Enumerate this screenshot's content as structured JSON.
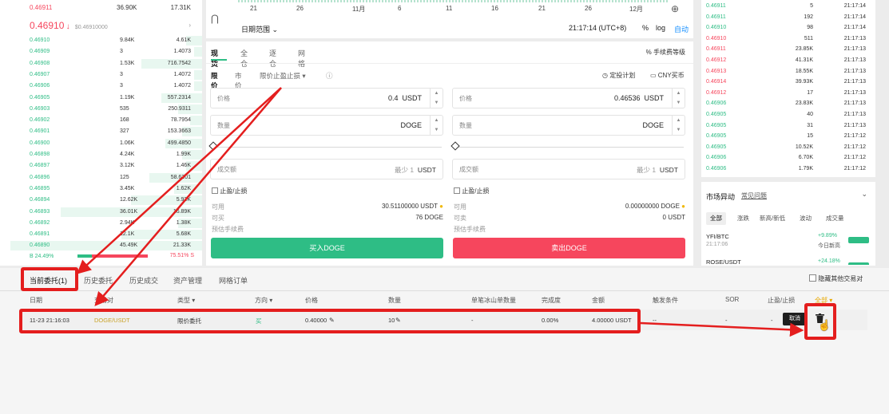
{
  "orderbook_left": {
    "top_row": {
      "price": "0.46911",
      "qty": "36.90K",
      "total": "17.31K"
    },
    "last_price": "0.46910",
    "last_arrow": "↓",
    "last_sub": "$0.46910000",
    "bids": [
      {
        "p": "0.46910",
        "q": "9.84K",
        "t": "4.61K"
      },
      {
        "p": "0.46909",
        "q": "3",
        "t": "1.4073"
      },
      {
        "p": "0.46908",
        "q": "1.53K",
        "t": "716.7542"
      },
      {
        "p": "0.46907",
        "q": "3",
        "t": "1.4072"
      },
      {
        "p": "0.46906",
        "q": "3",
        "t": "1.4072"
      },
      {
        "p": "0.46905",
        "q": "1.19K",
        "t": "557.2314"
      },
      {
        "p": "0.46903",
        "q": "535",
        "t": "250.9311"
      },
      {
        "p": "0.46902",
        "q": "168",
        "t": "78.7954"
      },
      {
        "p": "0.46901",
        "q": "327",
        "t": "153.3663"
      },
      {
        "p": "0.46900",
        "q": "1.06K",
        "t": "499.4850"
      },
      {
        "p": "0.46898",
        "q": "4.24K",
        "t": "1.99K"
      },
      {
        "p": "0.46897",
        "q": "3.12K",
        "t": "1.46K"
      },
      {
        "p": "0.46896",
        "q": "125",
        "t": "58.6201"
      },
      {
        "p": "0.46895",
        "q": "3.45K",
        "t": "1.62K"
      },
      {
        "p": "0.46894",
        "q": "12.62K",
        "t": "5.92K"
      },
      {
        "p": "0.46893",
        "q": "36.01K",
        "t": "16.89K"
      },
      {
        "p": "0.46892",
        "q": "2.94K",
        "t": "1.38K"
      },
      {
        "p": "0.46891",
        "q": "12.1K",
        "t": "5.68K"
      },
      {
        "p": "0.46890",
        "q": "45.49K",
        "t": "21.33K"
      }
    ],
    "ratio_buy": "B 24.49%",
    "ratio_sell": "75.51% S"
  },
  "chart": {
    "xticks": [
      "21",
      "26",
      "11月",
      "6",
      "11",
      "16",
      "21",
      "26",
      "12月"
    ],
    "date_range": "日期范围 ⌄",
    "time": "21:17:14 (UTC+8)",
    "pct": "%",
    "log": "log",
    "auto": "自动"
  },
  "trade": {
    "tabs": [
      "现货",
      "全仓",
      "逐仓",
      "网格"
    ],
    "fee": "手续费等级",
    "types": [
      "限价",
      "市价",
      "限价止盈止损 ▾"
    ],
    "plan": "定投计划",
    "cny": "CNY买币",
    "buy": {
      "price_label": "价格",
      "price": "0.4",
      "price_unit": "USDT",
      "qty_label": "数量",
      "qty_unit": "DOGE",
      "total_label": "成交额",
      "total_ph": "最少 1",
      "total_unit": "USDT",
      "tpsl": "止盈/止损",
      "avail_label": "可用",
      "avail": "30.51100000 USDT",
      "can_label": "可买",
      "can": "76 DOGE",
      "fee_est": "预估手续费",
      "btn": "买入DOGE"
    },
    "sell": {
      "price_label": "价格",
      "price": "0.46536",
      "price_unit": "USDT",
      "qty_label": "数量",
      "qty_unit": "DOGE",
      "total_label": "成交额",
      "total_ph": "最少 1",
      "total_unit": "USDT",
      "tpsl": "止盈/止损",
      "avail_label": "可用",
      "avail": "0.00000000 DOGE",
      "can_label": "可卖",
      "can": "0 USDT",
      "fee_est": "预估手续费",
      "btn": "卖出DOGE"
    }
  },
  "trades_right": [
    {
      "p": "0.46911",
      "q": "5",
      "t": "21:17:14"
    },
    {
      "p": "0.46911",
      "q": "192",
      "t": "21:17:14"
    },
    {
      "p": "0.46910",
      "q": "98",
      "t": "21:17:14"
    },
    {
      "p": "0.46910",
      "q": "511",
      "t": "21:17:13"
    },
    {
      "p": "0.46911",
      "q": "23.85K",
      "t": "21:17:13"
    },
    {
      "p": "0.46912",
      "q": "41.31K",
      "t": "21:17:13"
    },
    {
      "p": "0.46913",
      "q": "18.55K",
      "t": "21:17:13"
    },
    {
      "p": "0.46914",
      "q": "39.93K",
      "t": "21:17:13"
    },
    {
      "p": "0.46912",
      "q": "17",
      "t": "21:17:13"
    },
    {
      "p": "0.46906",
      "q": "23.83K",
      "t": "21:17:13"
    },
    {
      "p": "0.46905",
      "q": "40",
      "t": "21:17:13"
    },
    {
      "p": "0.46905",
      "q": "31",
      "t": "21:17:13"
    },
    {
      "p": "0.46905",
      "q": "15",
      "t": "21:17:12"
    },
    {
      "p": "0.46905",
      "q": "10.52K",
      "t": "21:17:12"
    },
    {
      "p": "0.46906",
      "q": "6.70K",
      "t": "21:17:12"
    },
    {
      "p": "0.46906",
      "q": "1.79K",
      "t": "21:17:12"
    }
  ],
  "market": {
    "title": "市场异动",
    "faq": "常见问题",
    "tabs": [
      "全部",
      "涨跌",
      "新高/新低",
      "波动",
      "成交量"
    ],
    "items": [
      {
        "pair": "YFI/BTC",
        "time": "21:17:06",
        "chg": "+9.89%",
        "label": "今日新高"
      },
      {
        "pair": "ROSE/USDT",
        "time": "",
        "chg": "+24.18%",
        "label": ""
      }
    ]
  },
  "orders": {
    "tabs": [
      "当前委托(1)",
      "历史委托",
      "历史成交",
      "资产管理",
      "网格订单"
    ],
    "hide_other": "隐藏其他交易对",
    "headers": [
      "日期",
      "交易对",
      "类型 ▾",
      "方向 ▾",
      "价格",
      "数量",
      "单笔冰山单数量",
      "完成度",
      "金额",
      "触发条件",
      "SOR",
      "止盈/止损",
      "全部 ▾"
    ],
    "row": {
      "date": "11-23 21:16:03",
      "pair": "DOGE/USDT",
      "type": "限价委托",
      "side": "买",
      "price": "0.40000",
      "qty": "10",
      "iceberg": "-",
      "fill": "0.00%",
      "amount": "4.00000 USDT",
      "trigger": "--",
      "sor": "-",
      "tpsl": "-",
      "cancel_tip": "取消"
    }
  },
  "colors": {
    "green": "#2ebd85",
    "red": "#f6465d",
    "auto": "#1890ff",
    "annot": "#e41e1e"
  }
}
